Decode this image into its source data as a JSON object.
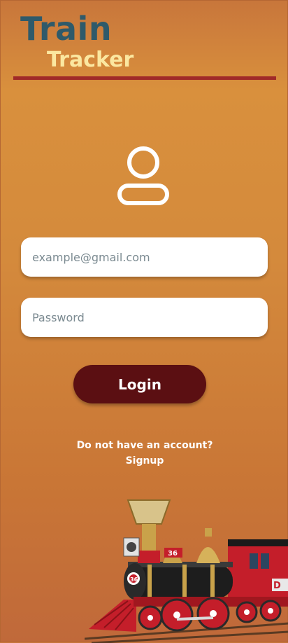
{
  "logo": {
    "line1": "Train",
    "line2": "Tracker"
  },
  "login_form": {
    "email_placeholder": "example@gmail.com",
    "password_placeholder": "Password",
    "login_label": "Login"
  },
  "account_prompt": "Do not have an account?",
  "signup_label": "Signup",
  "locomotive_number": "36",
  "colors": {
    "logo_train": "#2f5a6a",
    "logo_tracker": "#fbe7a0",
    "divider": "#a02a28",
    "login_button": "#5b0f12"
  }
}
